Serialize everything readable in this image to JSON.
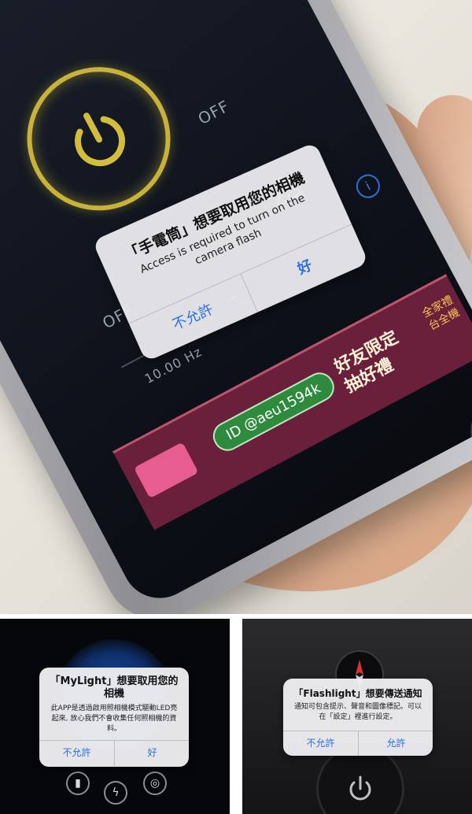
{
  "top_photo": {
    "screen_labels": {
      "off_1": "OFF",
      "off_2": "OFF",
      "frequency": "10.00 Hz",
      "plus": "+"
    },
    "banner": {
      "id_tag": "ID @aeu1594k",
      "promo": "好友限定\n抽好禮",
      "side_text": "全家禮\n台全機"
    },
    "alert": {
      "title": "「手電筒」想要取用您的相機",
      "message": "Access is required to turn on the camera flash",
      "deny": "不允許",
      "allow": "好"
    }
  },
  "panel_mylight": {
    "alert": {
      "title": "「MyLight」想要取用您的相機",
      "message": "此APP是透過啟用照相機模式驅動LED亮起來, 放心我們不會收集任何照相機的資料。",
      "deny": "不允許",
      "allow": "好"
    }
  },
  "panel_flashlight": {
    "alert": {
      "title": "「Flashlight」想要傳送通知",
      "message": "通知可包含提示、聲音和圖像標記。可以在「設定」裡進行設定。",
      "deny": "不允許",
      "allow": "允許"
    }
  },
  "colors": {
    "accent_blue": "#2d6fe3",
    "power_ring": "#c8b23a",
    "banner_bg": "#6a1f3a",
    "id_tag_green": "#2e8b3e"
  }
}
